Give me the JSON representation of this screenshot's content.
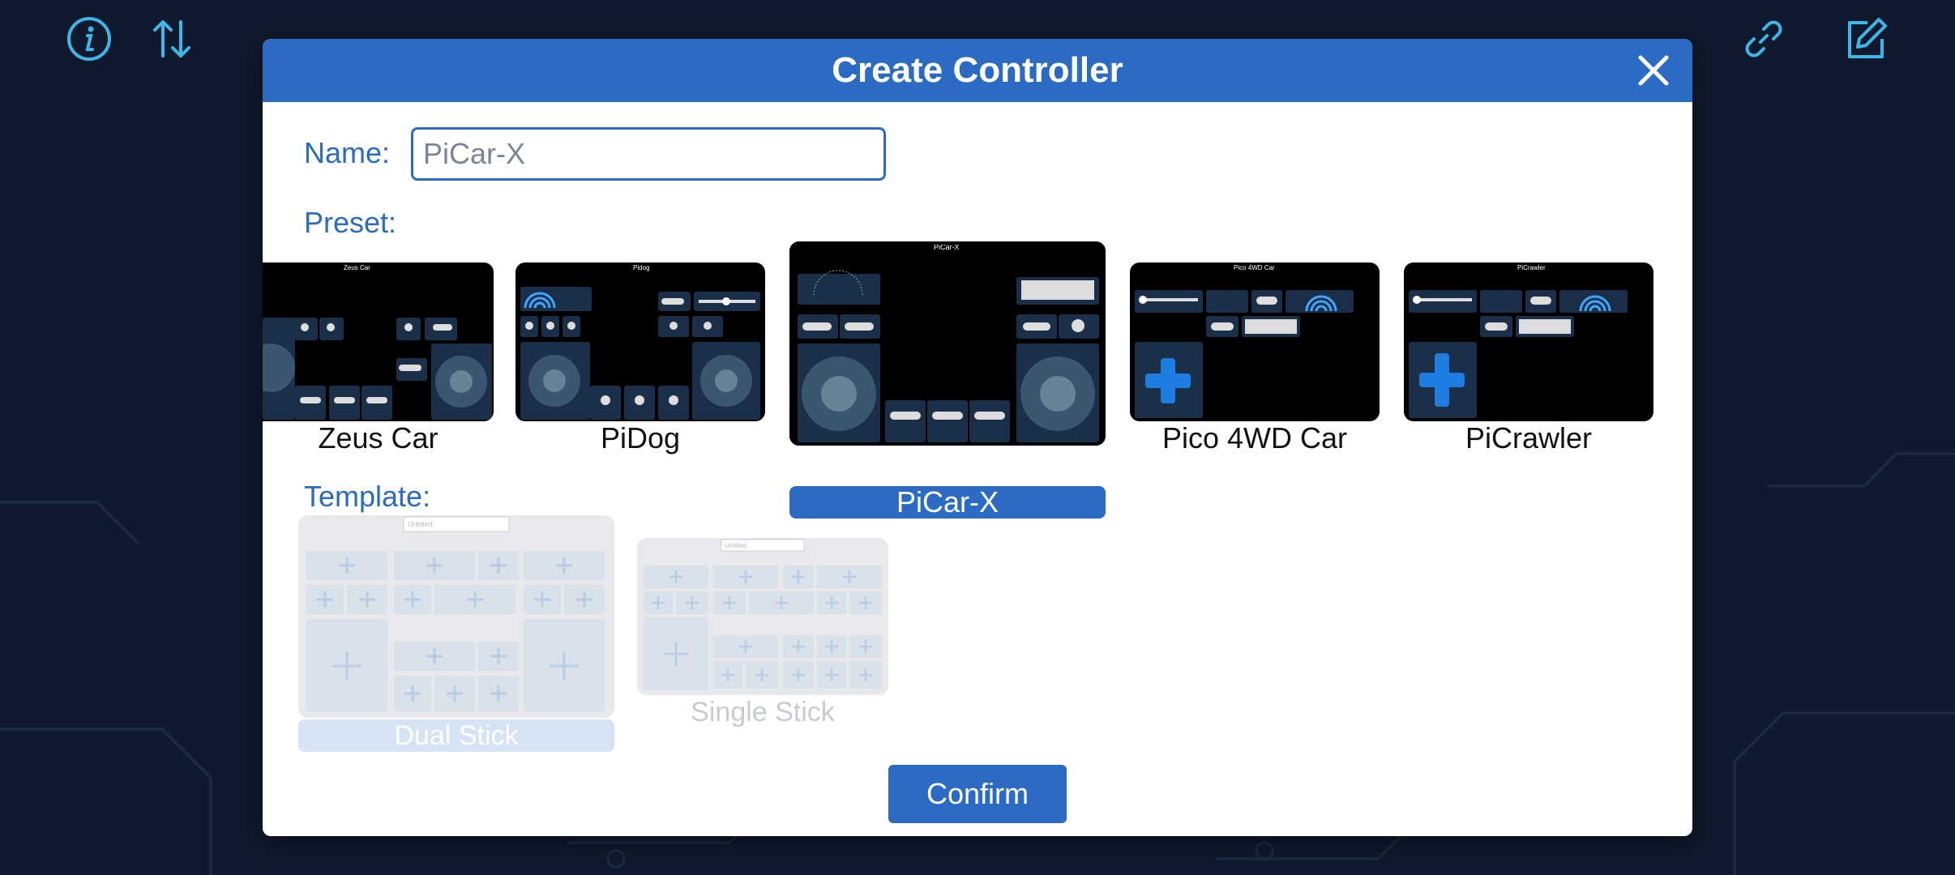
{
  "modal": {
    "title": "Create Controller",
    "name_label": "Name:",
    "name_value": "PiCar-X",
    "preset_label": "Preset:",
    "template_label": "Template:",
    "confirm_label": "Confirm"
  },
  "presets": [
    {
      "label": "Zeus Car",
      "thumb_title": "Zeus Car"
    },
    {
      "label": "PiDog",
      "thumb_title": "Pidog"
    },
    {
      "label": "PiCar-X",
      "thumb_title": "PiCar-X",
      "selected": true
    },
    {
      "label": "Pico 4WD Car",
      "thumb_title": "Pico 4WD Car"
    },
    {
      "label": "PiCrawler",
      "thumb_title": "PiCrawler"
    }
  ],
  "templates": [
    {
      "label": "Dual Stick",
      "thumb_title": "Untitled",
      "selected": true
    },
    {
      "label": "Single Stick",
      "thumb_title": "Untitled"
    }
  ],
  "icons": {
    "info": "info-icon",
    "sort": "sort-icon",
    "link": "link-icon",
    "edit": "edit-icon",
    "close": "close-icon"
  },
  "colors": {
    "background": "#0f1a2e",
    "accent": "#2c6bc3",
    "icon_cyan": "#3fb6e8"
  }
}
